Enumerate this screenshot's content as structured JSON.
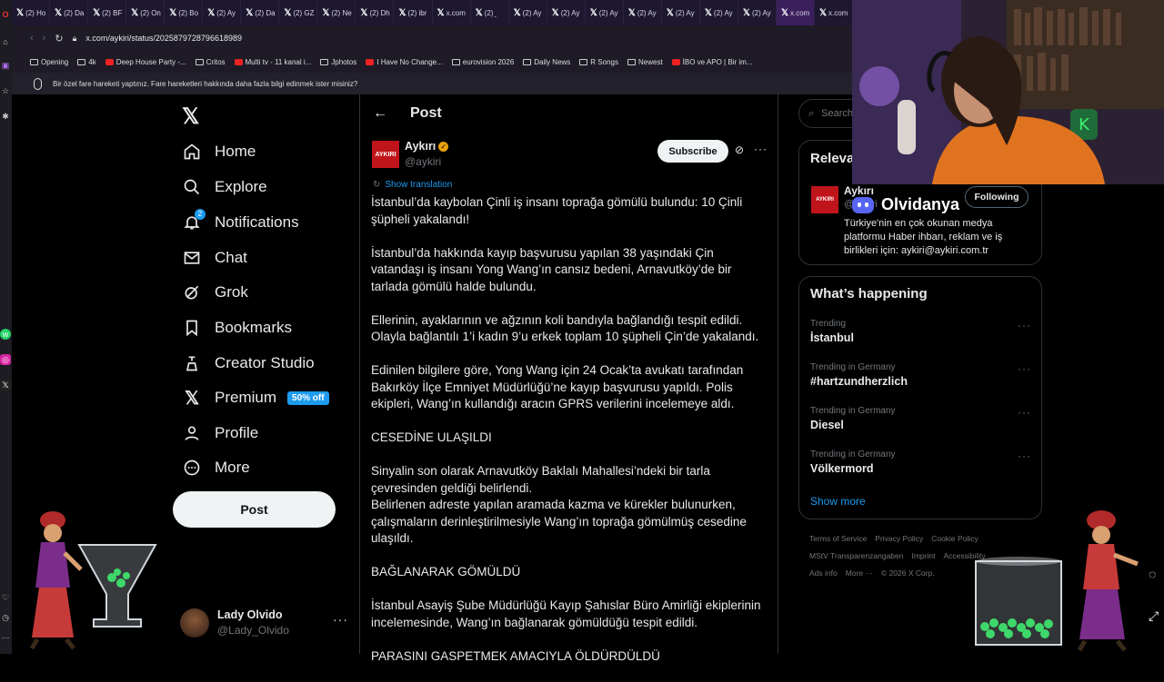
{
  "browser": {
    "tabs": [
      "(2) Ho",
      "(2) Da",
      "(2) BF",
      "(2) On",
      "(2) Bo",
      "(2) Ay",
      "(2) Da",
      "(2) GZ",
      "(2) Ne",
      "(2) Dh",
      "(2) ibr",
      "x.com",
      "(2) ̱",
      "(2) Ay",
      "(2) Ay",
      "(2) Ay",
      "(2) Ay",
      "(2) Ay",
      "(2) Ay",
      "(2) Ay",
      "x.com",
      "x.com"
    ],
    "url": "x.com/aykiri/status/2025879728796618989",
    "bookmarks": [
      "Opening",
      "4k",
      "Deep House Party -...",
      "Critos",
      "Multi tv - 11 kanal i...",
      "Jphotos",
      "I Have No Change...",
      "eurovision 2026",
      "Daily News",
      "R Songs",
      "Newest",
      "İBO ve APO | Bir im..."
    ],
    "notice": "Bir özel fare hareketi yaptınız. Fare hareketleri hakkında daha fazla bilgi edinmek ister misiniz?"
  },
  "nav": {
    "home": "Home",
    "explore": "Explore",
    "notifications": "Notifications",
    "notif_count": "2",
    "chat": "Chat",
    "grok": "Grok",
    "bookmarks": "Bookmarks",
    "creator": "Creator Studio",
    "premium": "Premium",
    "premium_badge": "50% off",
    "profile": "Profile",
    "more": "More",
    "post_button": "Post"
  },
  "account": {
    "name": "Lady Olvido",
    "handle": "@Lady_Olvido"
  },
  "post": {
    "header": "Post",
    "author_name": "Aykırı",
    "author_handle": "@aykiri",
    "avatar_text": "AYKIRI",
    "subscribe": "Subscribe",
    "show_translation": "Show translation",
    "paragraphs": [
      "İstanbul’da kaybolan Çinli iş insanı toprağa gömülü bulundu: 10 Çinli şüpheli yakalandı!",
      "İstanbul’da hakkında kayıp başvurusu yapılan 38 yaşındaki Çin vatandaşı iş insanı Yong Wang’ın cansız bedeni, Arnavutköy’de bir tarlada gömülü halde bulundu.",
      "Ellerinin, ayaklarının ve ağzının koli bandıyla bağlandığı tespit edildi. Olayla bağlantılı 1’i kadın 9’u erkek toplam 10 şüpheli Çin’de yakalandı.",
      "Edinilen bilgilere göre, Yong Wang için 24 Ocak’ta avukatı tarafından Bakırköy İlçe Emniyet Müdürlüğü’ne kayıp başvurusu yapıldı. Polis ekipleri, Wang’ın kullandığı aracın GPRS verilerini incelemeye aldı.",
      "CESEDİNE ULAŞILDI",
      "Sinyalin son olarak Arnavutköy Baklalı Mahallesi’ndeki bir tarla çevresinden geldiği belirlendi.\nBelirlenen adreste yapılan aramada kazma ve kürekler bulunurken, çalışmaların derinleştirilmesiyle Wang’ın toprağa gömülmüş cesedine ulaşıldı.",
      "BAĞLANARAK GÖMÜLDÜ",
      "İstanbul Asayiş Şube Müdürlüğü Kayıp Şahıslar Büro Amirliği ekiplerinin incelemesinde, Wang’ın bağlanarak gömüldüğü tespit edildi.",
      "PARASINI GASPETMEK AMACIYLA ÖLDÜRDÜLDÜ"
    ]
  },
  "sidebar": {
    "search_placeholder": "Search",
    "relevant_title": "Relevant people",
    "relevant_name": "Aykırı",
    "relevant_handle": "@aykiri",
    "following": "Following",
    "bio": "Türkiye'nin en çok okunan medya platformu Haber ihbarı, reklam ve iş birlikleri için: aykiri@aykiri.com.tr",
    "happening_title": "What’s happening",
    "trends": [
      {
        "kind": "Trending",
        "name": "İstanbul"
      },
      {
        "kind": "Trending in Germany",
        "name": "#hartzundherzlich"
      },
      {
        "kind": "Trending in Germany",
        "name": "Diesel"
      },
      {
        "kind": "Trending in Germany",
        "name": "Völkermord"
      }
    ],
    "show_more": "Show more",
    "footer": [
      "Terms of Service",
      "Privacy Policy",
      "Cookie Policy",
      "MStV Transparenzangaben",
      "Imprint",
      "Accessibility",
      "Ads info",
      "More ···",
      "© 2026 X Corp."
    ]
  },
  "overlay": {
    "discord_name": "Olvidanya"
  },
  "colors": {
    "accent": "#1d9bf0",
    "verified": "#e8a10c",
    "aykiri_red": "#c0141b",
    "discord": "#5865f2"
  }
}
